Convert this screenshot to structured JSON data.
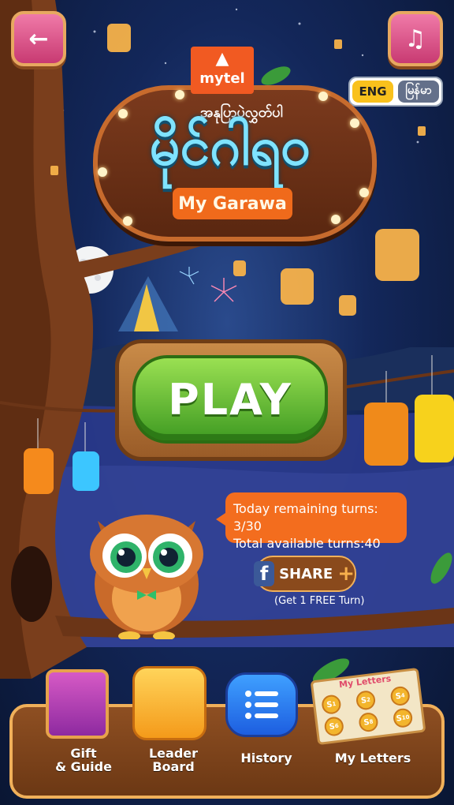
{
  "header": {
    "back_icon": "arrow-left-icon",
    "music_icon": "music-note-icon",
    "language": {
      "eng_label": "ENG",
      "mm_label": "မြန်မာ"
    }
  },
  "logo": {
    "brand": "mytel",
    "subtitle_my": "အနုပြာပဲ့လွှတ်ပါ",
    "title_my": "မိုင်ဂါရဝ",
    "title_en": "My Garawa"
  },
  "play": {
    "label": "PLAY"
  },
  "turns": {
    "today_remaining": "Today remaining turns: 3/30",
    "total_available": "Total available turns:40"
  },
  "share": {
    "fb_glyph": "f",
    "label": "SHARE",
    "plus": "+",
    "note": "(Get 1 FREE Turn)"
  },
  "nav": {
    "items": [
      {
        "label_line1": "Gift",
        "label_line2": "& Guide",
        "icon": "gift-guide-icon"
      },
      {
        "label_line1": "Leader",
        "label_line2": "Board",
        "icon": "leaderboard-icon"
      },
      {
        "label_line1": "History",
        "label_line2": "",
        "icon": "history-list-icon"
      },
      {
        "label_line1": "My Letters",
        "label_line2": "",
        "icon": "letters-icon"
      }
    ],
    "letters_card_title": "My Letters",
    "letters_coins": [
      "S",
      "S",
      "S",
      "S",
      "S",
      "S"
    ],
    "letter_coin_numbers": [
      "1",
      "2",
      "4",
      "6",
      "8",
      "10"
    ]
  },
  "colors": {
    "accent_orange": "#f36d1e",
    "play_green": "#5ebc33",
    "wood_brown": "#8e4f22",
    "pink_button": "#e05590"
  }
}
